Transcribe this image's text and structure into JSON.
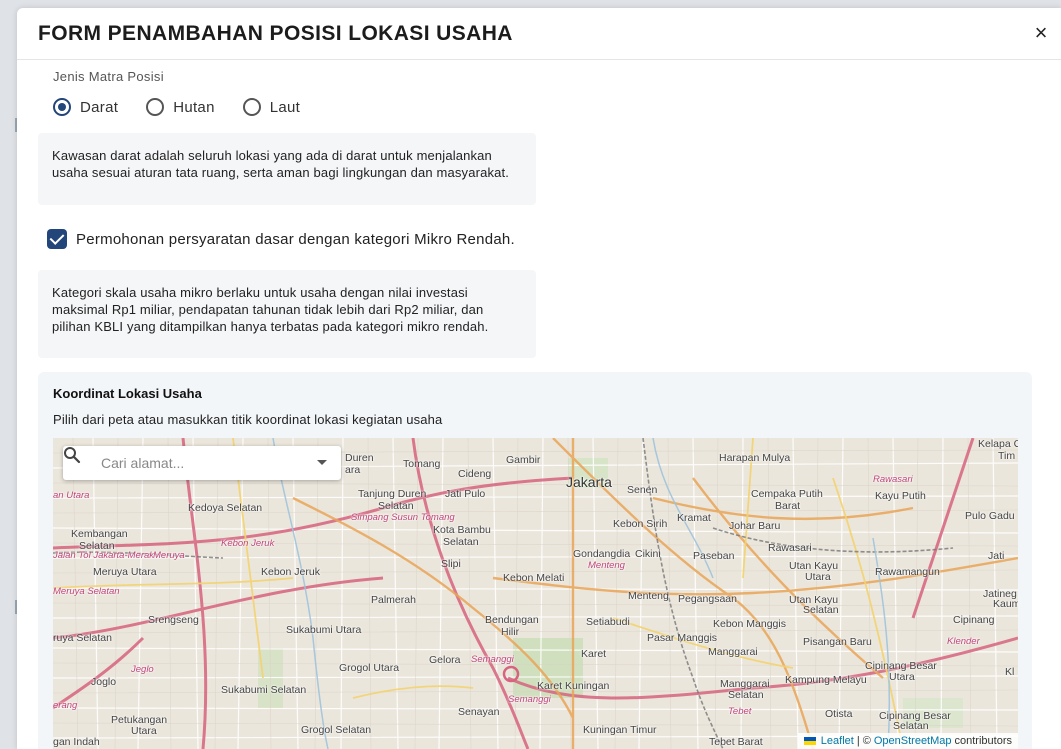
{
  "modal": {
    "title": "FORM PENAMBAHAN POSISI LOKASI USAHA",
    "close_icon": "×"
  },
  "jenis_matra": {
    "label": "Jenis Matra Posisi",
    "options": [
      {
        "label": "Darat",
        "selected": true
      },
      {
        "label": "Hutan",
        "selected": false
      },
      {
        "label": "Laut",
        "selected": false
      }
    ],
    "info": "Kawasan darat adalah seluruh lokasi yang ada di darat untuk menjalankan usaha sesuai aturan tata ruang, serta aman bagi lingkungan dan masyarakat."
  },
  "mikro": {
    "checkbox_label": "Permohonan persyaratan dasar dengan kategori Mikro Rendah.",
    "checked": true,
    "info": "Kategori skala usaha mikro berlaku untuk usaha dengan nilai investasi maksimal Rp1 miliar, pendapatan tahunan tidak lebih dari Rp2 miliar, dan pilihan KBLI yang ditampilkan hanya terbatas pada kategori mikro rendah."
  },
  "koordinat": {
    "title": "Koordinat Lokasi Usaha",
    "subtitle": "Pilih dari peta atau masukkan titik koordinat lokasi kegiatan usaha",
    "search_placeholder": "Cari alamat...",
    "attribution_leaflet": "Leaflet",
    "attribution_sep": "| ©",
    "attribution_osm": "OpenStreetMap",
    "attribution_contrib": "contributors",
    "map_labels": [
      {
        "text": "Jakarta",
        "big": true
      },
      {
        "text": "Harapan Mulya"
      },
      {
        "text": "Kelapa G"
      },
      {
        "text": "Tim"
      },
      {
        "text": "Gambir"
      },
      {
        "text": "Senen"
      },
      {
        "text": "Tomang"
      },
      {
        "text": "Cideng"
      },
      {
        "text": "Duren"
      },
      {
        "text": "ara"
      },
      {
        "text": "Rawasari",
        "road": true
      },
      {
        "text": "Kayu Putih"
      },
      {
        "text": "Cempaka Putih"
      },
      {
        "text": "Barat"
      },
      {
        "text": "Pulo Gadu"
      },
      {
        "text": "Tanjung Duren"
      },
      {
        "text": "Selatan"
      },
      {
        "text": "Jati Pulo"
      },
      {
        "text": "Kedoya Selatan"
      },
      {
        "text": "an Utara",
        "road": true
      },
      {
        "text": "Simpang Susun Tomang",
        "road": true
      },
      {
        "text": "Kebon Sirih"
      },
      {
        "text": "Kramat"
      },
      {
        "text": "Johar Baru"
      },
      {
        "text": "Kota Bambu"
      },
      {
        "text": "Selatan"
      },
      {
        "text": "Kembangan"
      },
      {
        "text": "Selatan"
      },
      {
        "text": "Jalan Tol Jakarta-Merak",
        "road": true
      },
      {
        "text": "Meruya",
        "road": true
      },
      {
        "text": "Kebon Jeruk",
        "road": true
      },
      {
        "text": "Gondangdia"
      },
      {
        "text": "Cikini"
      },
      {
        "text": "Paseban"
      },
      {
        "text": "Rawasari"
      },
      {
        "text": "Jati"
      },
      {
        "text": "Menteng",
        "road": true
      },
      {
        "text": "Utan Kayu"
      },
      {
        "text": "Utara"
      },
      {
        "text": "Rawamangun"
      },
      {
        "text": "Meruya Utara"
      },
      {
        "text": "Kebon Jeruk"
      },
      {
        "text": "Slipi"
      },
      {
        "text": "Kebon Melati"
      },
      {
        "text": "Meruya Selatan",
        "road": true
      },
      {
        "text": "Palmerah"
      },
      {
        "text": "Menteng"
      },
      {
        "text": "Pegangsaan"
      },
      {
        "text": "Utan Kayu"
      },
      {
        "text": "Selatan"
      },
      {
        "text": "Jatineg"
      },
      {
        "text": "Kaum"
      },
      {
        "text": "Srengseng"
      },
      {
        "text": "Bendungan"
      },
      {
        "text": "Hilir"
      },
      {
        "text": "Setiabudi"
      },
      {
        "text": "Kebon Manggis"
      },
      {
        "text": "Cipinang"
      },
      {
        "text": "ruya Selatan"
      },
      {
        "text": "Sukabumi Utara"
      },
      {
        "text": "Pasar Manggis"
      },
      {
        "text": "Pisangan Baru"
      },
      {
        "text": "Karet"
      },
      {
        "text": "Manggarai"
      },
      {
        "text": "Grogol Utara"
      },
      {
        "text": "Gelora"
      },
      {
        "text": "Semanggi",
        "road": true
      },
      {
        "text": "Cipinang Besar"
      },
      {
        "text": "Utara"
      },
      {
        "text": "Joglo"
      },
      {
        "text": "Jeglo",
        "road": true
      },
      {
        "text": "Sukabumi Selatan"
      },
      {
        "text": "Karet Kuningan"
      },
      {
        "text": "Manggarai"
      },
      {
        "text": "Selatan"
      },
      {
        "text": "Kampung Melayu"
      },
      {
        "text": "Semanggi",
        "road": true
      },
      {
        "text": "Senayan"
      },
      {
        "text": "Tebet",
        "road": true
      },
      {
        "text": "Otista"
      },
      {
        "text": "Cipinang Besar"
      },
      {
        "text": "Selatan"
      },
      {
        "text": "Petukangan"
      },
      {
        "text": "Utara"
      },
      {
        "text": "Grogol Selatan"
      },
      {
        "text": "Kuningan Timur"
      },
      {
        "text": "Tebet Barat"
      },
      {
        "text": "gan Indah"
      },
      {
        "text": "Klender",
        "road": true
      },
      {
        "text": "Kl"
      },
      {
        "text": "erang",
        "road": true
      }
    ]
  },
  "colors": {
    "primary": "#22457a",
    "panel_bg": "#f3f6f9",
    "info_bg": "#f5f6f8"
  }
}
